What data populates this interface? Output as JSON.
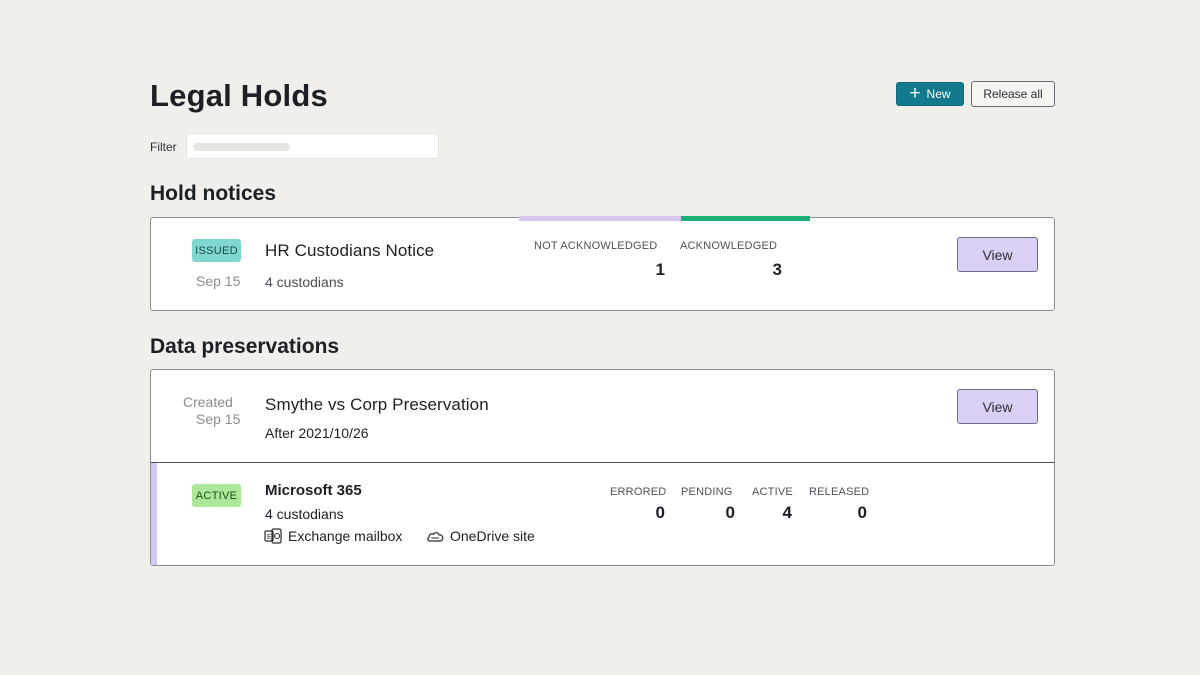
{
  "page": {
    "title": "Legal Holds"
  },
  "toolbar": {
    "new_label": "New",
    "release_all_label": "Release all"
  },
  "filter": {
    "label": "Filter",
    "value": ""
  },
  "hold_notices": {
    "section_title": "Hold notices",
    "items": [
      {
        "status": "ISSUED",
        "date": "Sep 15",
        "title": "HR Custodians Notice",
        "subtitle": "4 custodians",
        "not_acknowledged_label": "NOT ACKNOWLEDGED",
        "not_acknowledged_value": "1",
        "acknowledged_label": "ACKNOWLEDGED",
        "acknowledged_value": "3",
        "view_label": "View"
      }
    ]
  },
  "data_preservations": {
    "section_title": "Data preservations",
    "items": [
      {
        "created_label": "Created",
        "date": "Sep 15",
        "title": "Smythe vs Corp Preservation",
        "subtitle": "After 2021/10/26",
        "view_label": "View",
        "sources": [
          {
            "status": "ACTIVE",
            "name": "Microsoft 365",
            "custodians": "4 custodians",
            "locations": [
              {
                "label": "Exchange mailbox",
                "icon": "exchange-icon"
              },
              {
                "label": "OneDrive site",
                "icon": "onedrive-icon"
              }
            ],
            "stats": {
              "errored_label": "ERRORED",
              "errored_value": "0",
              "pending_label": "PENDING",
              "pending_value": "0",
              "active_label": "ACTIVE",
              "active_value": "4",
              "released_label": "RELEASED",
              "released_value": "0"
            }
          }
        ]
      }
    ]
  },
  "colors": {
    "background": "#f0efeb",
    "primary_button": "#127a8c",
    "view_button": "#dccff5",
    "issued_badge": "#7ed8cf",
    "active_badge": "#abe899",
    "not_acknowledged_bar": "#d7c8f1",
    "acknowledged_bar": "#1ab074"
  }
}
